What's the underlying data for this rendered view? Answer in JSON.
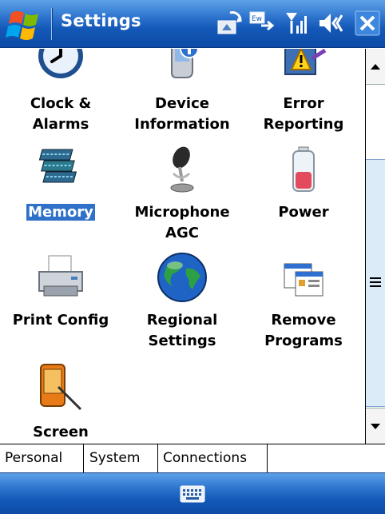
{
  "titlebar": {
    "title": "Settings",
    "icons": [
      "start-flag-icon",
      "sync-icon",
      "keyboard-input-icon",
      "signal-icon",
      "volume-icon",
      "close-icon"
    ]
  },
  "items": [
    {
      "name": "clock-alarms",
      "line1": "Clock &",
      "line2": "Alarms",
      "icon": "clock-icon"
    },
    {
      "name": "device-information",
      "line1": "Device",
      "line2": "Information",
      "icon": "device-info-icon"
    },
    {
      "name": "error-reporting",
      "line1": "Error",
      "line2": "Reporting",
      "icon": "error-reporting-icon"
    },
    {
      "name": "memory",
      "line1": "Memory",
      "line2": "",
      "icon": "memory-icon",
      "selected": true
    },
    {
      "name": "microphone-agc",
      "line1": "Microphone",
      "line2": "AGC",
      "icon": "microphone-icon"
    },
    {
      "name": "power",
      "line1": "Power",
      "line2": "",
      "icon": "battery-icon"
    },
    {
      "name": "print-config",
      "line1": "Print Config",
      "line2": "",
      "icon": "printer-icon"
    },
    {
      "name": "regional-settings",
      "line1": "Regional",
      "line2": "Settings",
      "icon": "globe-icon"
    },
    {
      "name": "remove-programs",
      "line1": "Remove",
      "line2": "Programs",
      "icon": "remove-programs-icon"
    },
    {
      "name": "screen",
      "line1": "Screen",
      "line2": "",
      "icon": "screen-icon"
    }
  ],
  "tabs": [
    {
      "label": "Personal",
      "active": false
    },
    {
      "label": "System",
      "active": true
    },
    {
      "label": "Connections",
      "active": false
    }
  ],
  "menubar": {
    "icon": "keyboard-icon"
  },
  "colors": {
    "titlebar": "#2f76cf",
    "selection": "#2f71c8"
  }
}
